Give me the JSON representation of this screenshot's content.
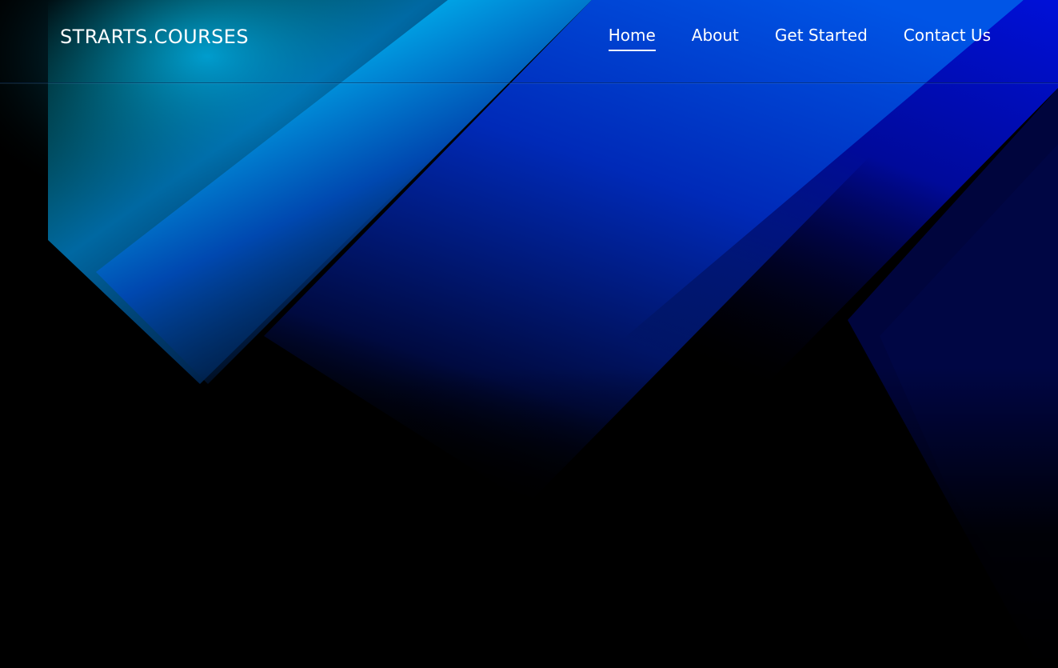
{
  "site": {
    "logo": "STRARTS.COURSES"
  },
  "nav": {
    "items": [
      {
        "label": "Home",
        "active": true
      },
      {
        "label": "About",
        "active": false
      },
      {
        "label": "Get Started",
        "active": false
      },
      {
        "label": "Contact Us",
        "active": false
      }
    ]
  },
  "theme": {
    "background": "#000000",
    "cyan": "#00f0e8",
    "blue": "#0078d8",
    "deep_blue": "#0010c0",
    "text": "#ffffff"
  }
}
